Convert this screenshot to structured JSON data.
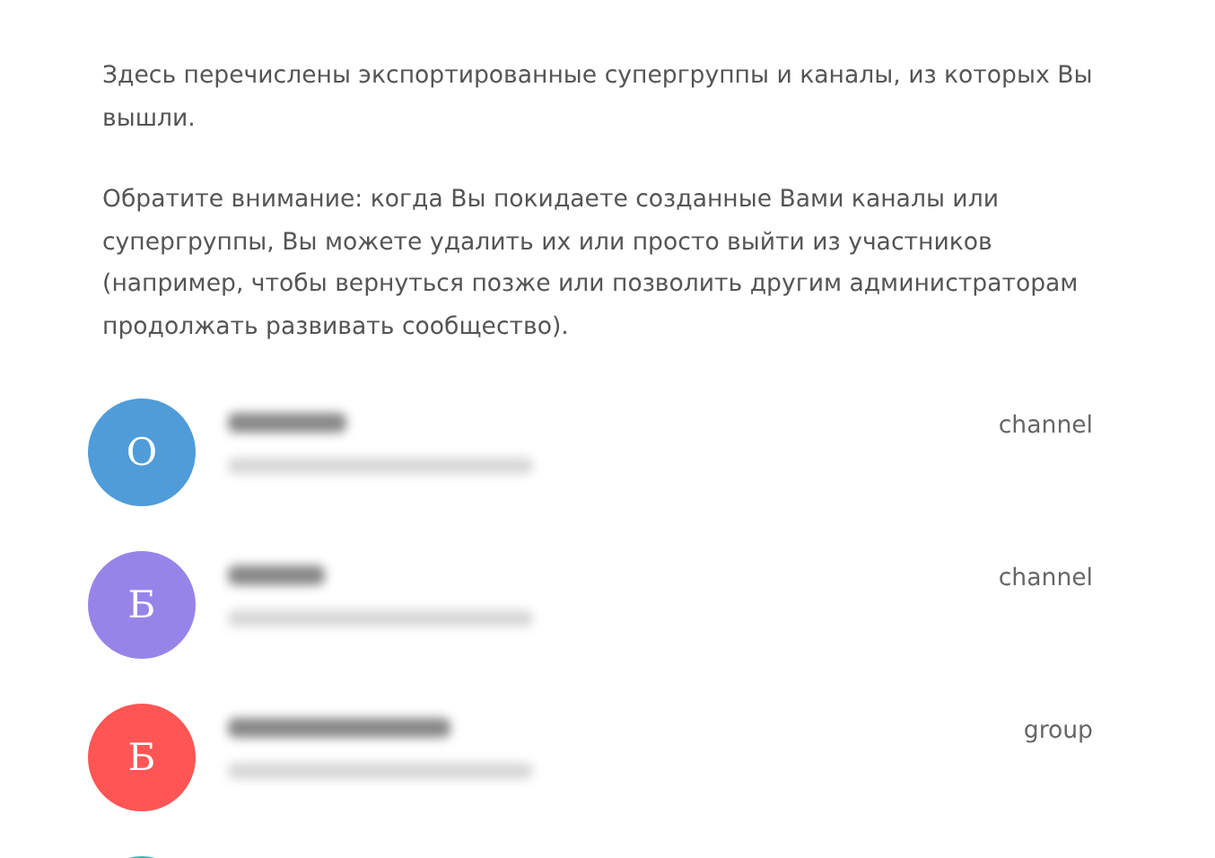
{
  "intro": [
    "Здесь перечислены экспортированные супергруппы и каналы, из которых Вы вышли.",
    "Обратите внимание: когда Вы покидаете созданные Вами каналы или супергруппы, Вы можете удалить их или просто выйти из участников (например, чтобы вернуться позже или позволить другим администраторам продолжать развивать сообщество)."
  ],
  "chats": [
    {
      "initial": "О",
      "color": "#4f9cd9",
      "type": "channel",
      "kind": "full"
    },
    {
      "initial": "Б",
      "color": "#9884e8",
      "type": "channel",
      "kind": "full"
    },
    {
      "initial": "Б",
      "color": "#ff5555",
      "type": "group",
      "kind": "full"
    },
    {
      "color": "#40b5b5",
      "kind": "cut"
    }
  ]
}
